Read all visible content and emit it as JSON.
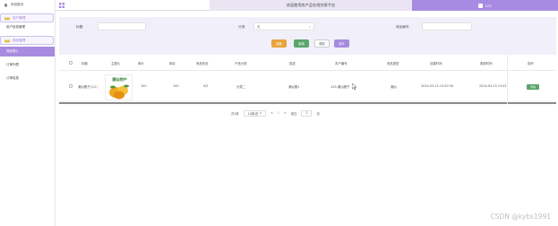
{
  "sidebar": {
    "home_label": "系统首页",
    "groups": [
      {
        "label": "用户管理",
        "items": [
          "用户信息管理"
        ]
      },
      {
        "label": "商品管理",
        "items": [
          "商品表()",
          "订单列表",
          "订单信息"
        ]
      }
    ],
    "active_item": "商品表()"
  },
  "topbar": {
    "title": "欢迎使用农产品在线交易平台",
    "user": "123"
  },
  "search": {
    "fields": [
      {
        "label": "标题:",
        "value": ""
      },
      {
        "label": "分类:",
        "value": "无"
      },
      {
        "label": "商品编号:",
        "value": ""
      }
    ],
    "buttons": {
      "search": "搜索",
      "add": "新增",
      "delete": "删除",
      "stats": "统计"
    }
  },
  "table": {
    "headers": [
      "标题",
      "主图片",
      "单价",
      "库存",
      "商品状态",
      "产品分类",
      "描述",
      "农户编号",
      "商品类型",
      "创建时间",
      "更新时间",
      "操作"
    ],
    "rows": [
      {
        "title": "潮汕猪子(1/1)",
        "image_caption": "潮汕特产",
        "price": "100",
        "stock": "100",
        "status": "0/2",
        "category": "分类二",
        "description": "潮汕猪1",
        "farmer_no": "123-潮汕猪子",
        "type": "潮汕",
        "created": "2024-03-13 15:50:34",
        "updated": "2024-03-13 15:52",
        "action": "详情"
      }
    ]
  },
  "pager": {
    "total": "共1条",
    "page_size": "10条/页",
    "prev": "<",
    "current": "1",
    "next": ">",
    "goto_label": "前往",
    "goto_value": "1",
    "page_suffix": "页"
  },
  "watermark": "CSDN @kybs1991",
  "colors": {
    "accent": "#a68ae1",
    "search_btn": "#e8a33d",
    "add_btn": "#5aa56a"
  }
}
